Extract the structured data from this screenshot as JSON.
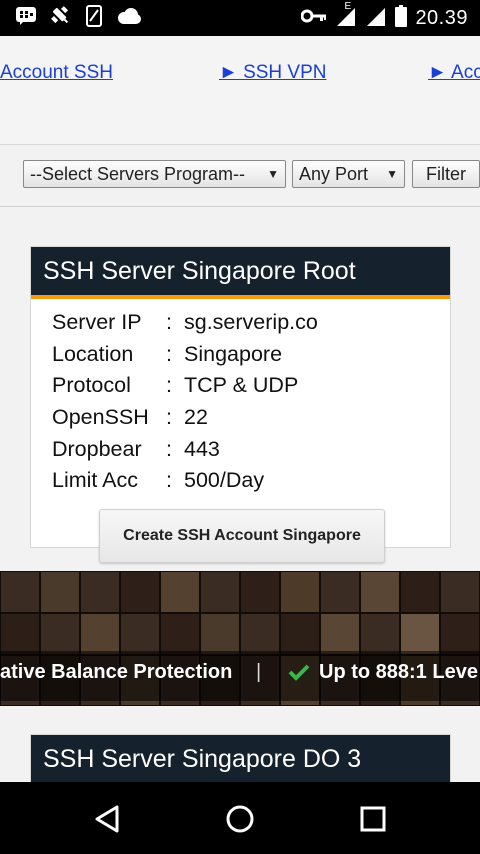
{
  "status_bar": {
    "time": "20.39",
    "icons": [
      "bbm-icon",
      "satellite-icon",
      "phone-icon",
      "cloud-icon",
      "key-icon",
      "signal-e-icon",
      "signal-icon",
      "battery-icon"
    ],
    "network_label": "E"
  },
  "topnav": {
    "links": [
      "Account SSH",
      "► SSH VPN",
      "► Acc"
    ]
  },
  "filter": {
    "program_select": "--Select Servers Program--",
    "port_select": "Any Port",
    "filter_button": "Filter"
  },
  "card1": {
    "title": "SSH Server Singapore Root",
    "separator": ":",
    "rows": [
      {
        "label": "Server IP",
        "value": "sg.serverip.co"
      },
      {
        "label": "Location",
        "value": "Singapore"
      },
      {
        "label": "Protocol",
        "value": "TCP & UDP"
      },
      {
        "label": "OpenSSH",
        "value": "22"
      },
      {
        "label": "Dropbear",
        "value": "443"
      },
      {
        "label": "Limit Acc",
        "value": "500/Day"
      }
    ],
    "button": "Create SSH Account Singapore"
  },
  "banner": {
    "text1": "ative Balance Protection",
    "divider": "|",
    "text2": "Up to 888:1 Leve"
  },
  "card2": {
    "title": "SSH Server Singapore DO 3"
  },
  "colors": {
    "link": "#1a3fd6",
    "card_header": "#15212c",
    "card_accent": "#f39c12",
    "check": "#39b54a"
  },
  "navigation": {
    "icons": [
      "back-icon",
      "home-icon",
      "recents-icon"
    ]
  }
}
